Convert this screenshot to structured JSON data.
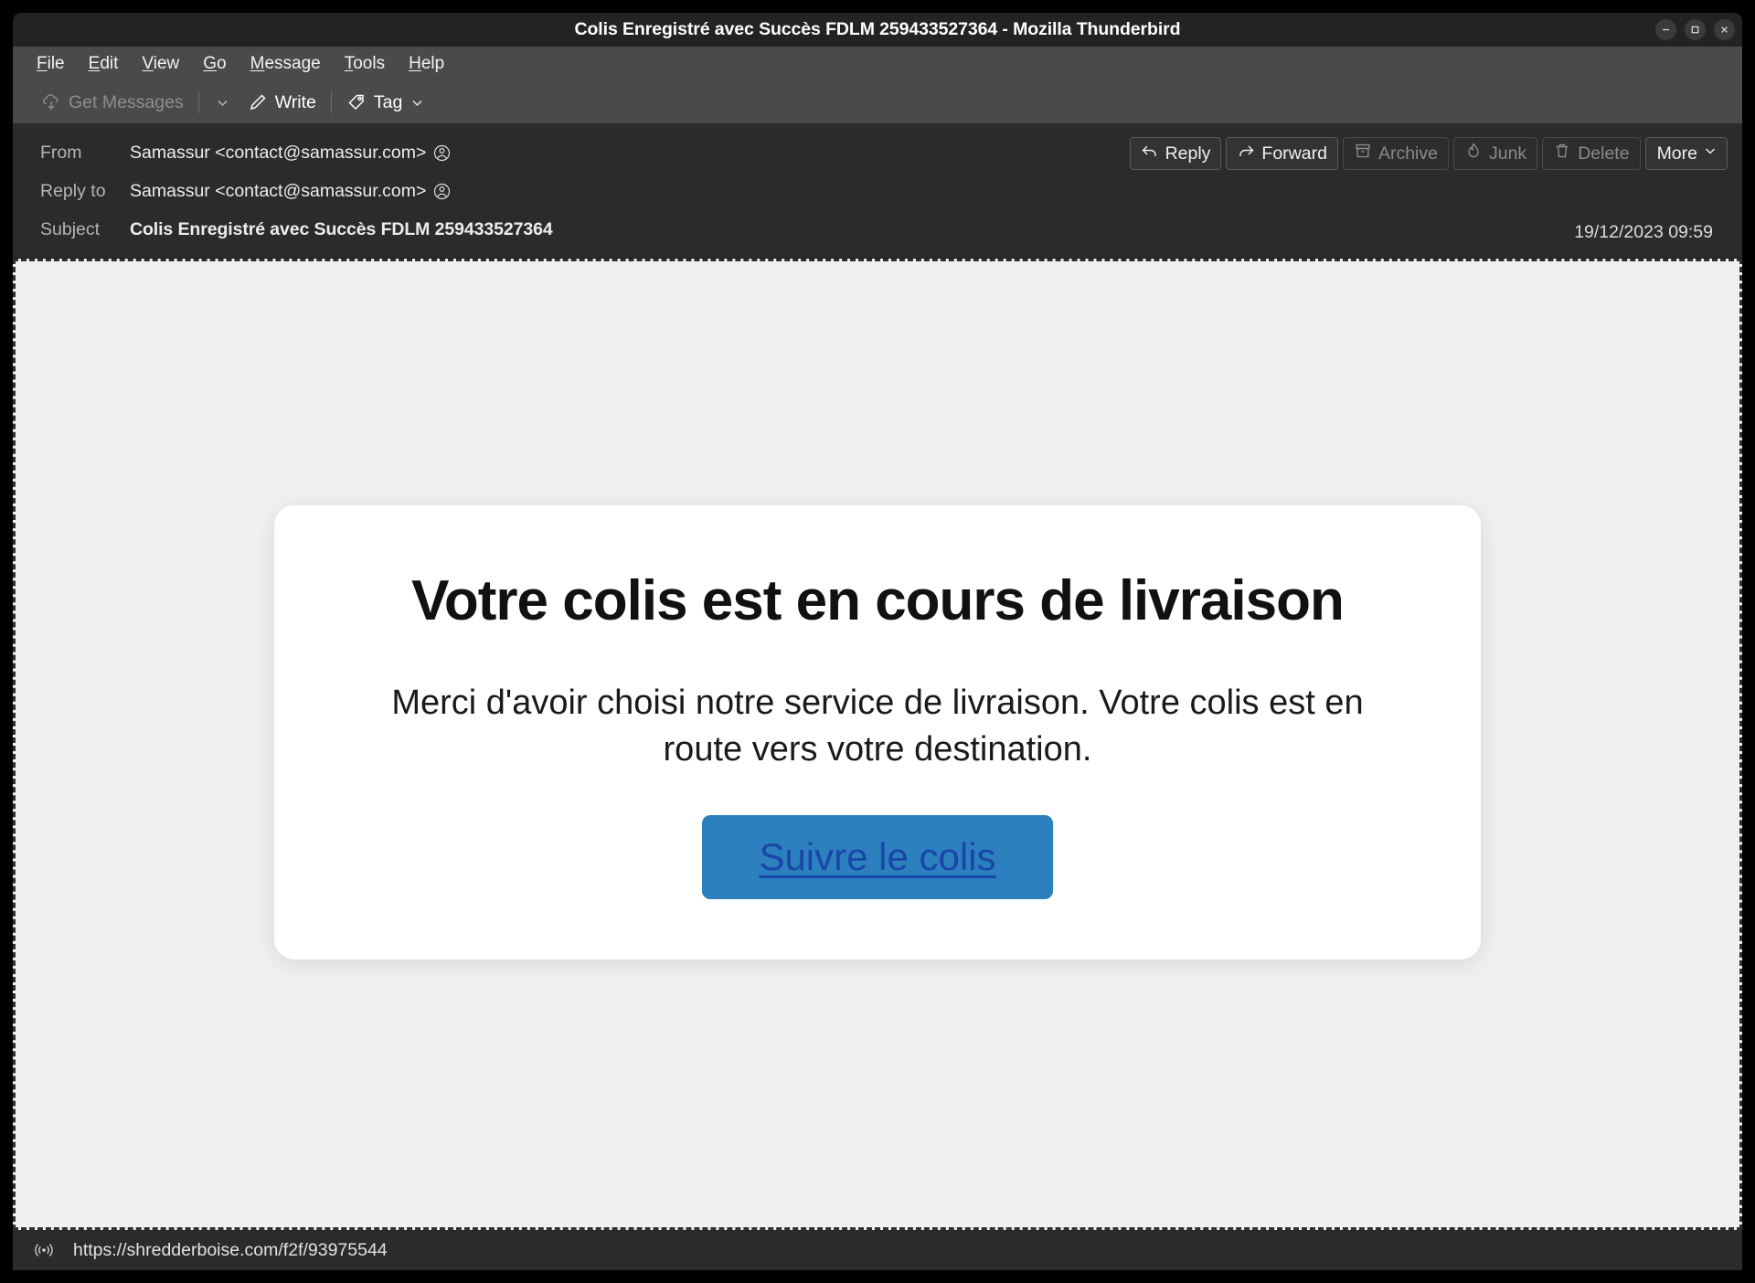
{
  "window": {
    "title": "Colis Enregistré avec Succès FDLM 259433527364 - Mozilla Thunderbird",
    "controls": {
      "minimize": "minimize-button",
      "maximize": "maximize-button",
      "close": "close-button"
    }
  },
  "menubar": {
    "items": [
      {
        "label": "File",
        "accel": "F",
        "rest": "ile"
      },
      {
        "label": "Edit",
        "accel": "E",
        "rest": "dit"
      },
      {
        "label": "View",
        "accel": "V",
        "rest": "iew"
      },
      {
        "label": "Go",
        "accel": "G",
        "rest": "o"
      },
      {
        "label": "Message",
        "accel": "M",
        "rest": "essage"
      },
      {
        "label": "Tools",
        "accel": "T",
        "rest": "ools"
      },
      {
        "label": "Help",
        "accel": "H",
        "rest": "elp"
      }
    ]
  },
  "toolbar": {
    "get_messages_label": "Get Messages",
    "get_messages_icon": "cloud-download-icon",
    "get_messages_disabled": true,
    "get_messages_chevron": "chevron-down-icon",
    "write_label": "Write",
    "write_icon": "pencil-icon",
    "tag_label": "Tag",
    "tag_icon": "tag-icon",
    "tag_chevron": "chevron-down-icon"
  },
  "message": {
    "from_label": "From",
    "from_value": "Samassur <contact@samassur.com>",
    "reply_to_label": "Reply to",
    "reply_to_value": "Samassur <contact@samassur.com>",
    "subject_label": "Subject",
    "subject_value": "Colis Enregistré avec Succès FDLM 259433527364",
    "date": "19/12/2023 09:59",
    "contact_icon": "contact-avatar-icon"
  },
  "actions": [
    {
      "label": "Reply",
      "icon": "reply-arrow-icon",
      "disabled": false
    },
    {
      "label": "Forward",
      "icon": "forward-arrow-icon",
      "disabled": false
    },
    {
      "label": "Archive",
      "icon": "archive-box-icon",
      "disabled": true
    },
    {
      "label": "Junk",
      "icon": "flame-icon",
      "disabled": true
    },
    {
      "label": "Delete",
      "icon": "trash-icon",
      "disabled": true
    },
    {
      "label": "More",
      "icon": "chevron-down-icon",
      "disabled": false
    }
  ],
  "email": {
    "heading": "Votre colis est en cours de livraison",
    "paragraph": "Merci d'avoir choisi notre service de livraison. Votre colis est en route vers votre destination.",
    "cta_label": "Suivre le colis",
    "cta_bg": "#2b80bd",
    "cta_text_color": "#1a46a8",
    "card_bg": "#ffffff",
    "page_bg": "#f0f0f0"
  },
  "statusbar": {
    "url": "https://shredderboise.com/f2f/93975544",
    "icon": "link-broadcast-icon"
  }
}
